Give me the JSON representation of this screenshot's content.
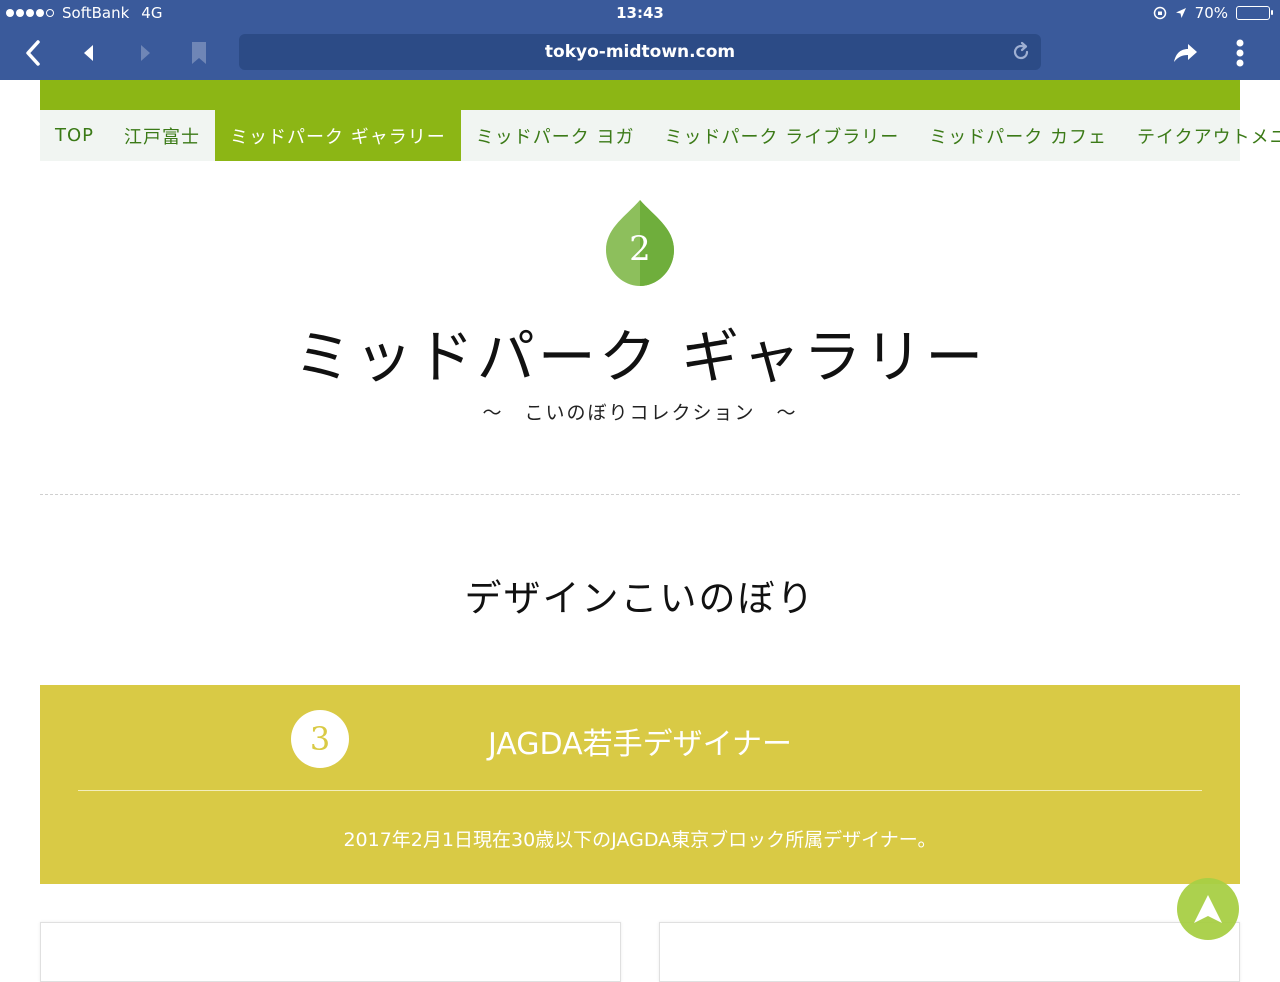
{
  "status": {
    "carrier": "SoftBank",
    "network": "4G",
    "time": "13:43",
    "battery": "70%",
    "battery_level": 0.7
  },
  "browser": {
    "url": "tokyo-midtown.com"
  },
  "nav": {
    "tabs": [
      {
        "label": "TOP"
      },
      {
        "label": "江戸富士"
      },
      {
        "label": "ミッドパーク ギャラリー"
      },
      {
        "label": "ミッドパーク ヨガ"
      },
      {
        "label": "ミッドパーク ライブラリー"
      },
      {
        "label": "ミッドパーク カフェ"
      },
      {
        "label": "テイクアウトメニュー"
      }
    ],
    "active_index": 2
  },
  "hero": {
    "leaf_number": "2",
    "title": "ミッドパーク ギャラリー",
    "subtitle": "～　こいのぼりコレクション　～"
  },
  "section": {
    "title": "デザインこいのぼり"
  },
  "category": {
    "number": "3",
    "heading": "JAGDA若手デザイナー",
    "description": "2017年2月1日現在30歳以下のJAGDA東京ブロック所属デザイナー。"
  },
  "colors": {
    "browser_bar": "#3a5a9b",
    "accent_green": "#8cb615",
    "tab_text": "#3b7a17",
    "category_yellow": "#d9ca45",
    "scroll_top_button": "#a8cf45"
  }
}
